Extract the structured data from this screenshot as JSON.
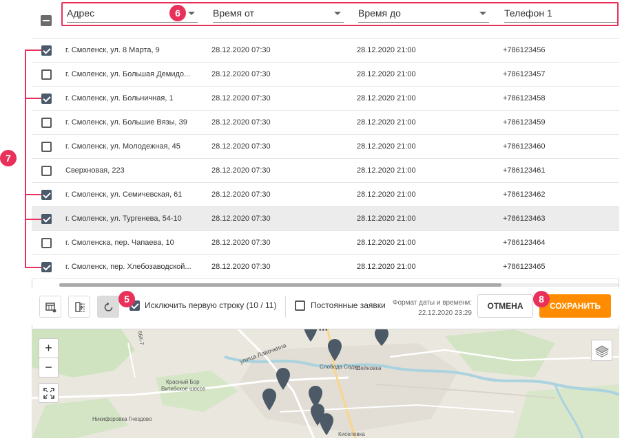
{
  "header": {
    "columns": [
      {
        "label": "Адрес"
      },
      {
        "label": "Время от"
      },
      {
        "label": "Время до"
      },
      {
        "label": "Телефон 1"
      }
    ]
  },
  "rows": [
    {
      "address": "г. Смоленск, ул. 8 Марта, 9",
      "from": "28.12.2020 07:30",
      "to": "28.12.2020 21:00",
      "phone": "+786123456",
      "checked": true
    },
    {
      "address": "г. Смоленск, ул. Большая Демидо...",
      "from": "28.12.2020 07:30",
      "to": "28.12.2020 21:00",
      "phone": "+786123457",
      "checked": false
    },
    {
      "address": "г. Смоленск, ул. Больничная, 1",
      "from": "28.12.2020 07:30",
      "to": "28.12.2020 21:00",
      "phone": "+786123458",
      "checked": true
    },
    {
      "address": "г. Смоленск, ул. Большие Вязы, 39",
      "from": "28.12.2020 07:30",
      "to": "28.12.2020 21:00",
      "phone": "+786123459",
      "checked": false
    },
    {
      "address": "г. Смоленск, ул. Молодежная, 45",
      "from": "28.12.2020 07:30",
      "to": "28.12.2020 21:00",
      "phone": "+786123460",
      "checked": false
    },
    {
      "address": "Сверхновая, 223",
      "from": "28.12.2020 07:30",
      "to": "28.12.2020 21:00",
      "phone": "+786123461",
      "checked": false
    },
    {
      "address": "г. Смоленск, ул. Семичевская, 61",
      "from": "28.12.2020 07:30",
      "to": "28.12.2020 21:00",
      "phone": "+786123462",
      "checked": true
    },
    {
      "address": "г. Смоленск, ул. Тургенева, 54-10",
      "from": "28.12.2020 07:30",
      "to": "28.12.2020 21:00",
      "phone": "+786123463",
      "checked": true,
      "highlighted": true
    },
    {
      "address": "г. Смоленска, пер. Чапаева, 10",
      "from": "28.12.2020 07:30",
      "to": "28.12.2020 21:00",
      "phone": "+786123464",
      "checked": false
    },
    {
      "address": "г. Смоленск, пер. Хлебозаводской...",
      "from": "28.12.2020 07:30",
      "to": "28.12.2020 21:00",
      "phone": "+786123465",
      "checked": true
    }
  ],
  "toolbar": {
    "exclude_first_row_label": "Исключить первую строку (10 / 11)",
    "exclude_first_row_checked": true,
    "permanent_orders_label": "Постоянные заявки",
    "permanent_orders_checked": false,
    "date_format_label": "Формат даты и времени:",
    "date_format_value": "22.12.2020 23:29",
    "cancel_label": "ОТМЕНА",
    "save_label": "СОХРАНИТЬ"
  },
  "map": {
    "zoom_in": "+",
    "zoom_out": "−",
    "labels": [
      "улица Лавочкина",
      "Слобода Садки",
      "Шейновка",
      "Красный Бор",
      "Витебское шоссе",
      "Никифоровка Гнездово",
      "Киселевка",
      "66К-7"
    ]
  },
  "badges": {
    "header": "6",
    "rows": "7",
    "toolbar": "5",
    "save": "8"
  },
  "colors": {
    "accent": "#e8305a",
    "save": "#ff8c00",
    "checkbox": "#4a5a6a"
  }
}
